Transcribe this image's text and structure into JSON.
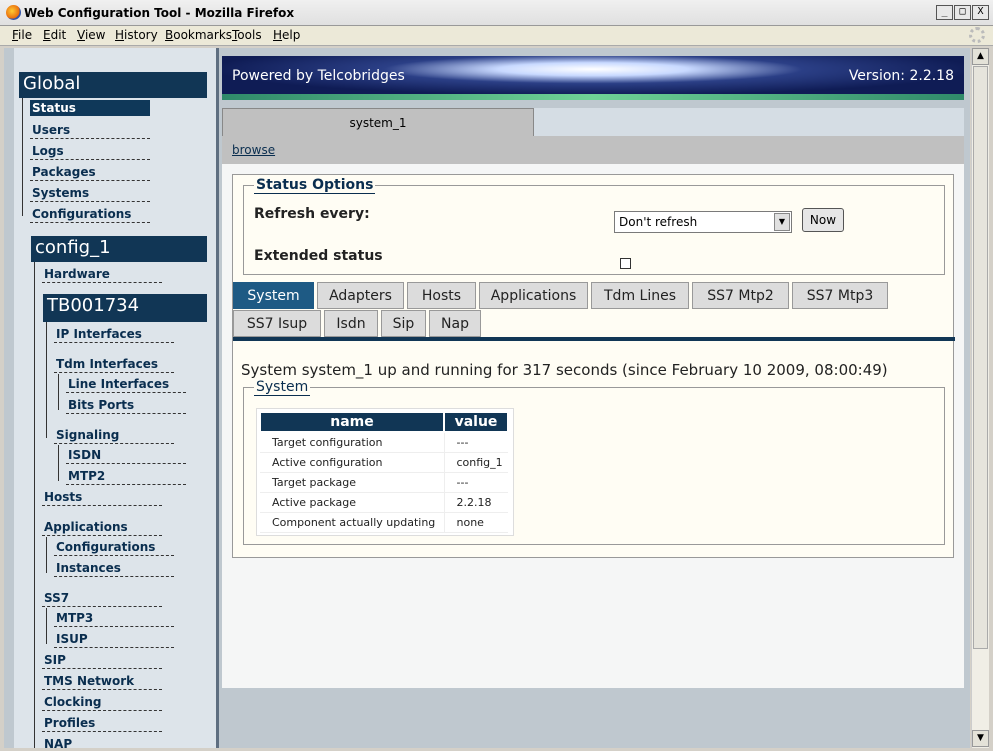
{
  "window": {
    "title": "Web Configuration Tool - Mozilla Firefox",
    "minimize": "_",
    "maximize": "□",
    "close": "X"
  },
  "menu": [
    {
      "label": "File",
      "u": "F",
      "rest": "ile"
    },
    {
      "label": "Edit",
      "u": "E",
      "rest": "dit"
    },
    {
      "label": "View",
      "u": "V",
      "rest": "iew"
    },
    {
      "label": "History",
      "u": "H",
      "rest": "istory"
    },
    {
      "label": "Bookmarks",
      "u": "B",
      "rest": "ookmarks"
    },
    {
      "label": "Tools",
      "u": "T",
      "rest": "ools"
    },
    {
      "label": "Help",
      "u": "H",
      "rest": "elp"
    }
  ],
  "nav": {
    "global_title": "Global",
    "global_items": [
      "Status",
      "Users",
      "Logs",
      "Packages",
      "Systems",
      "Configurations"
    ],
    "config_title": "config_1",
    "hardware": "Hardware",
    "tb_title": "TB001734",
    "ip_interfaces": "IP Interfaces",
    "tdm_interfaces": "Tdm Interfaces",
    "line_interfaces": "Line Interfaces",
    "bits_ports": "Bits Ports",
    "signaling": "Signaling",
    "isdn": "ISDN",
    "mtp2": "MTP2",
    "hosts": "Hosts",
    "applications": "Applications",
    "app_configurations": "Configurations",
    "instances": "Instances",
    "ss7": "SS7",
    "mtp3": "MTP3",
    "isup": "ISUP",
    "sip": "SIP",
    "tms_network": "TMS Network",
    "clocking": "Clocking",
    "profiles": "Profiles",
    "nap": "NAP"
  },
  "banner": {
    "powered": "Powered by Telcobridges",
    "version": "Version: 2.2.18"
  },
  "system_tab": "system_1",
  "browse_link": "browse",
  "status_options": {
    "legend": "Status Options",
    "refresh_label": "Refresh every:",
    "refresh_value": "Don't refresh",
    "now_button": "Now",
    "extended_label": "Extended status"
  },
  "tabs": [
    "System",
    "Adapters",
    "Hosts",
    "Applications",
    "Tdm Lines",
    "SS7 Mtp2",
    "SS7 Mtp3",
    "SS7 Isup",
    "Isdn",
    "Sip",
    "Nap"
  ],
  "status_message": "System system_1 up and running for 317 seconds (since February 10 2009, 08:00:49)",
  "system_box": {
    "legend": "System",
    "col_name": "name",
    "col_value": "value",
    "rows": [
      {
        "name": "Target configuration",
        "value": "---"
      },
      {
        "name": "Active configuration",
        "value": "config_1"
      },
      {
        "name": "Target package",
        "value": "---"
      },
      {
        "name": "Active package",
        "value": "2.2.18"
      },
      {
        "name": "Component actually updating",
        "value": "none"
      }
    ]
  }
}
